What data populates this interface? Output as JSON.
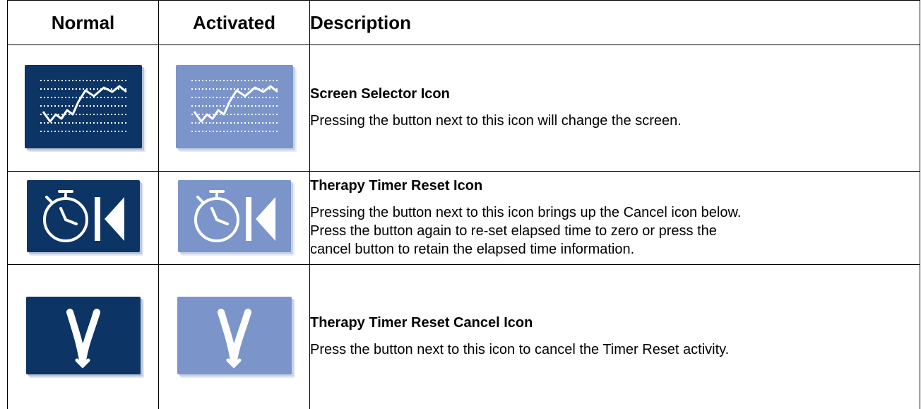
{
  "table": {
    "headers": {
      "normal": "Normal",
      "activated": "Activated",
      "description": "Description"
    },
    "rows": [
      {
        "icon": "screen-selector-icon",
        "title": "Screen Selector Icon",
        "text": "Pressing the button next to this icon will change the screen."
      },
      {
        "icon": "therapy-timer-reset-icon",
        "title": "Therapy Timer Reset Icon",
        "text": "Pressing the button next to this icon brings up the Cancel icon below.\nPress the button again to re-set elapsed time to zero or press the\ncancel button to retain the elapsed time information."
      },
      {
        "icon": "therapy-timer-reset-cancel-icon",
        "title": "Therapy Timer Reset Cancel Icon",
        "text": "Press the button next to this icon to cancel the Timer Reset activity."
      }
    ]
  },
  "colors": {
    "normal_icon_bg": "#0c3465",
    "activated_icon_bg": "#7b95ca",
    "icon_glyph": "#ffffff"
  }
}
